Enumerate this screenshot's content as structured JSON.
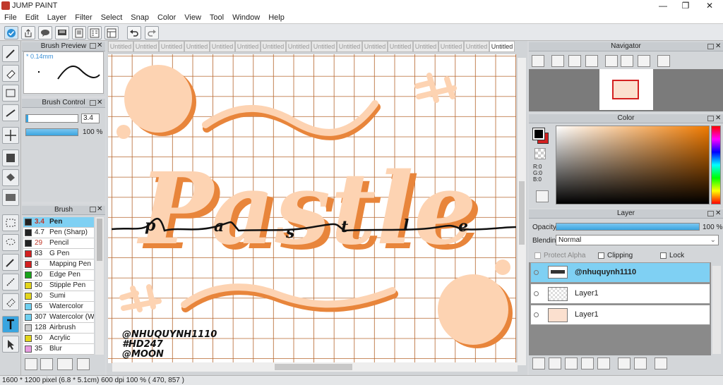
{
  "window": {
    "title": "JUMP PAINT",
    "controls": [
      "—",
      "❐",
      "✕"
    ]
  },
  "menu": [
    "File",
    "Edit",
    "Layer",
    "Filter",
    "Select",
    "Snap",
    "Color",
    "View",
    "Tool",
    "Window",
    "Help"
  ],
  "brush_preview": {
    "title": "Brush Preview",
    "size_label": "* 0.14mm"
  },
  "brush_control": {
    "title": "Brush Control",
    "size_value": "3.4",
    "opacity_value": "100 %"
  },
  "brush": {
    "title": "Brush",
    "items": [
      {
        "size": "3.4",
        "name": "Pen",
        "color": "#222222",
        "selected": true
      },
      {
        "size": "4.7",
        "name": "Pen (Sharp)",
        "color": "#222222"
      },
      {
        "size": "29",
        "name": "Pencil",
        "color": "#222222"
      },
      {
        "size": "83",
        "name": "G Pen",
        "color": "#d32020"
      },
      {
        "size": "8",
        "name": "Mapping Pen",
        "color": "#d32020"
      },
      {
        "size": "20",
        "name": "Edge Pen",
        "color": "#19a319"
      },
      {
        "size": "50",
        "name": "Stipple Pen",
        "color": "#e3d51a"
      },
      {
        "size": "30",
        "name": "Sumi",
        "color": "#e3d51a"
      },
      {
        "size": "65",
        "name": "Watercolor",
        "color": "#6fd0f0"
      },
      {
        "size": "307",
        "name": "Watercolor (We",
        "color": "#6fd0f0"
      },
      {
        "size": "128",
        "name": "Airbrush",
        "color": "#cccccc"
      },
      {
        "size": "50",
        "name": "Acrylic",
        "color": "#e3d51a"
      },
      {
        "size": "35",
        "name": "Blur",
        "color": "#e89ce0"
      }
    ]
  },
  "tabs": [
    "Untitled",
    "Untitled",
    "Untitled",
    "Untitled",
    "Untitled",
    "Untitled",
    "Untitled",
    "Untitled",
    "Untitled",
    "Untitled",
    "Untitled",
    "Untitled",
    "Untitled",
    "Untitled",
    "Untitled",
    "Untitled"
  ],
  "artwork": {
    "word": "Pastle",
    "lowercase_letters": "pastle",
    "credits": [
      "@NHUQUYNH1110",
      "#HD247",
      "@MOON"
    ]
  },
  "navigator": {
    "title": "Navigator"
  },
  "color_panel": {
    "title": "Color",
    "r": "R:0",
    "g": "G:0",
    "b": "B:0"
  },
  "layer_panel": {
    "title": "Layer",
    "opacity_label": "Opacity",
    "opacity_value": "100 %",
    "opacity_fraction": 1.0,
    "blending_label": "Blending",
    "blending_value": "Normal",
    "protect_alpha": "Protect Alpha",
    "clipping": "Clipping",
    "lock": "Lock",
    "layers": [
      {
        "name": "@nhuquynh1110",
        "selected": true
      },
      {
        "name": "Layer1"
      },
      {
        "name": "Layer1"
      }
    ]
  },
  "status": "1600 * 1200 pixel   (6.8 * 5.1cm)   600 dpi   100 %   ( 470, 857 )",
  "colors": {
    "accent": "#3aa5e0",
    "peach": "#fdd3b2",
    "orange": "#e8853b",
    "grid": "#b5652c"
  }
}
